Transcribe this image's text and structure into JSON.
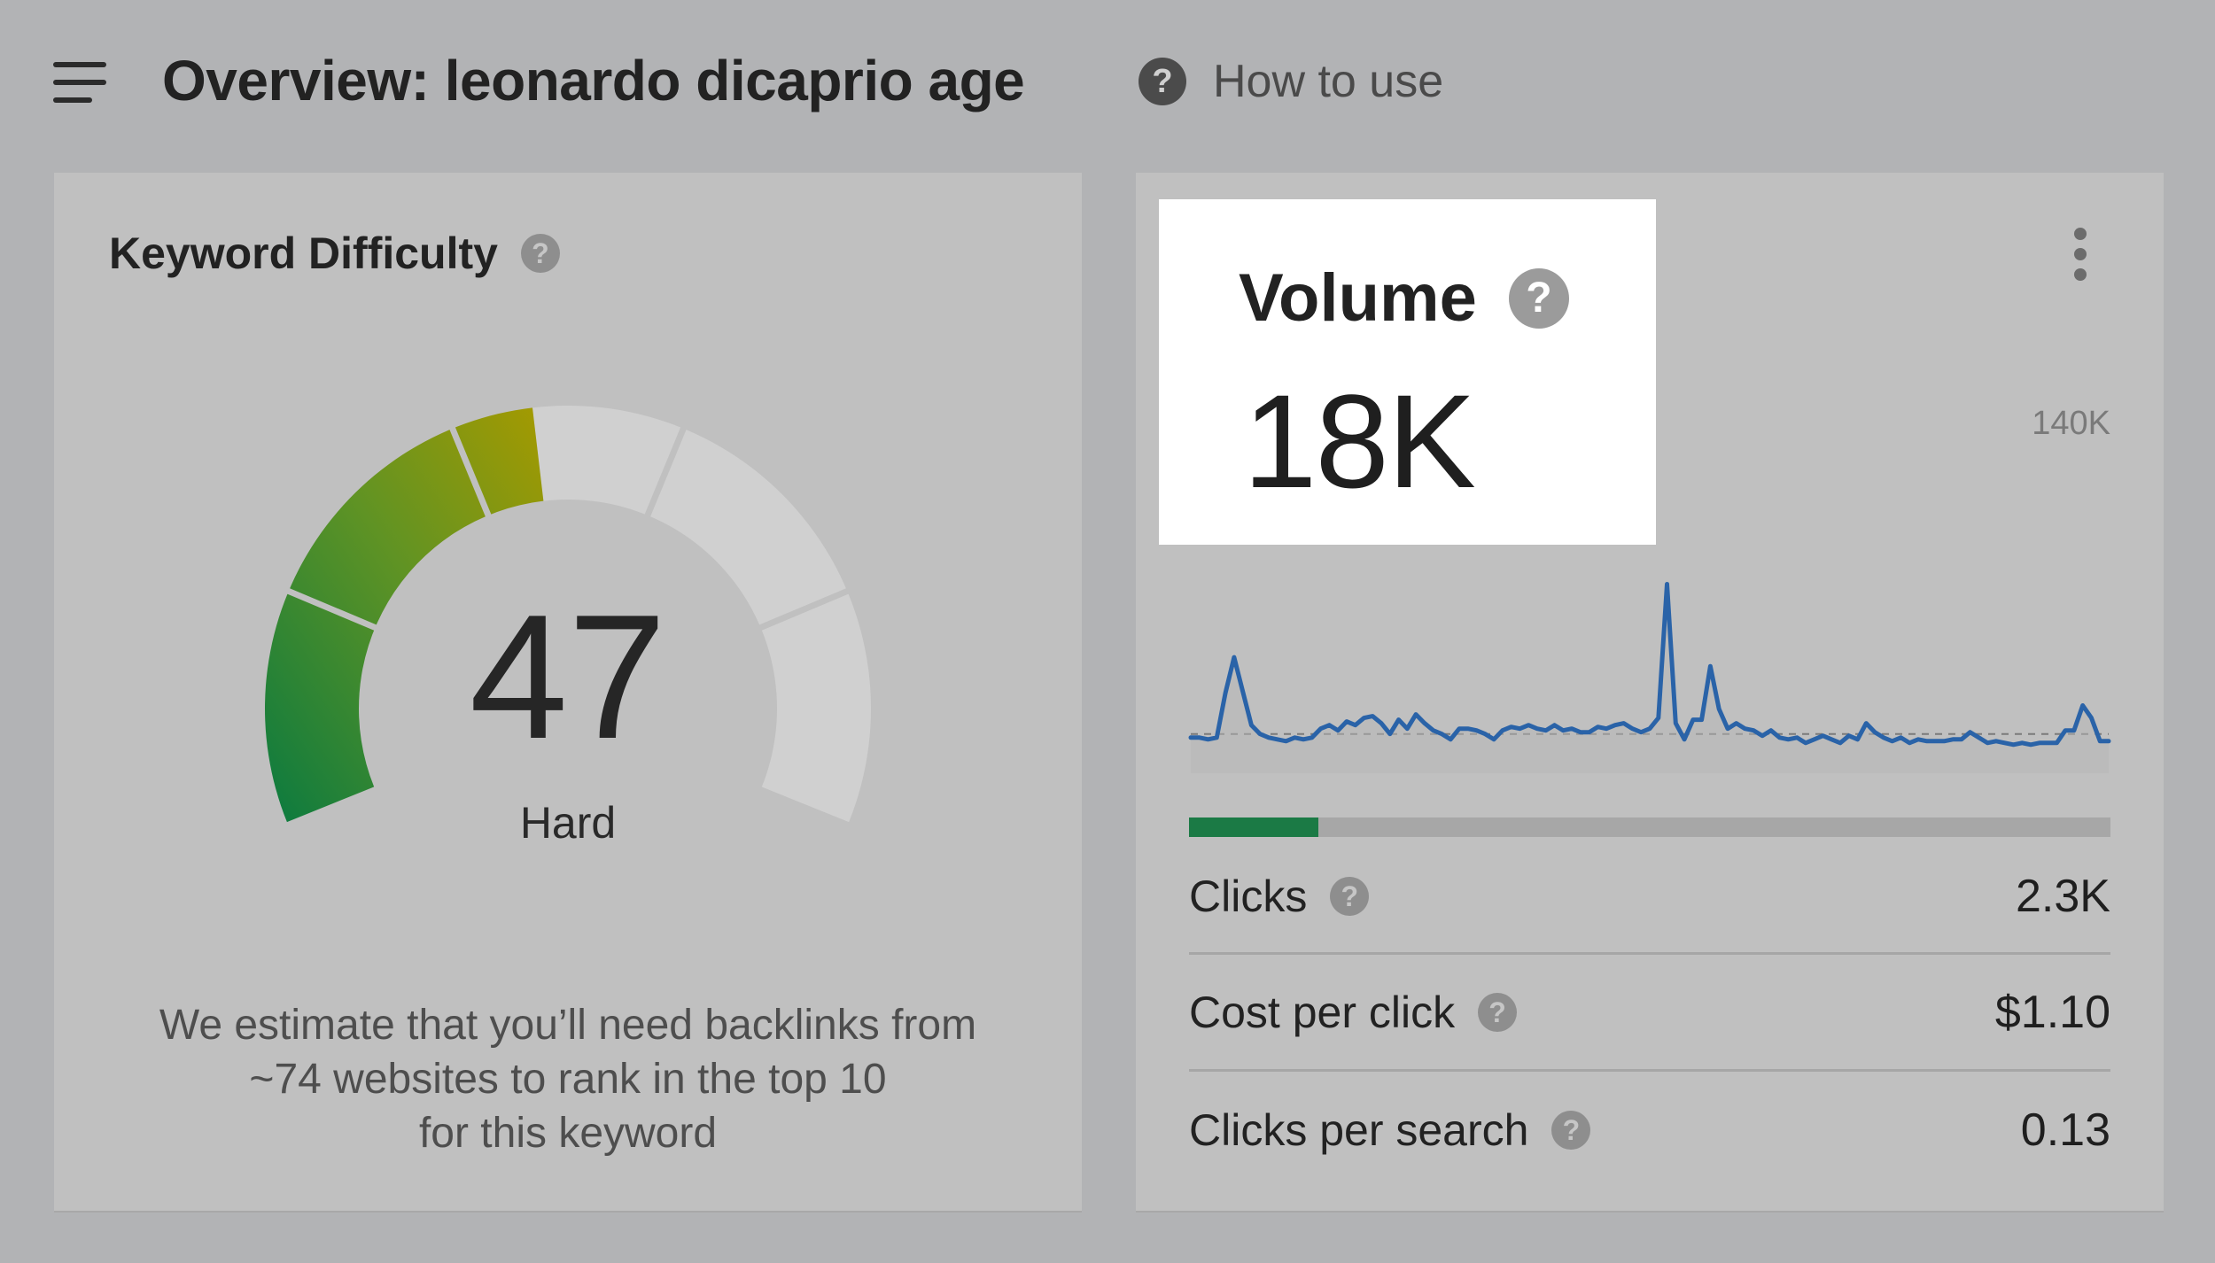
{
  "header": {
    "title": "Overview: leonardo dicaprio age",
    "help_label": "How to use",
    "help_icon": "?"
  },
  "keyword_difficulty": {
    "title": "Keyword Difficulty",
    "help_icon": "?",
    "value": 47,
    "value_text": "47",
    "level": "Hard",
    "description_lines": [
      "We estimate that you’ll need backlinks from",
      "~74 websites to rank in the top 10",
      "for this keyword"
    ],
    "gauge_colors": {
      "green": "#0a7a40",
      "olive": "#7c9a1e",
      "yellow": "#a59a00",
      "track": "#d0d0d0"
    }
  },
  "volume": {
    "title": "Volume",
    "help_icon": "?",
    "value_text": "18K",
    "axis_max": "140K",
    "clicks_share": 0.14,
    "line_color": "#2a63a8",
    "bar_color": "#1b7a45",
    "metrics": [
      {
        "label": "Clicks",
        "value": "2.3K"
      },
      {
        "label": "Cost per click",
        "value": "$1.10"
      },
      {
        "label": "Clicks per search",
        "value": "0.13"
      }
    ]
  },
  "chart_data": {
    "type": "line",
    "series": [
      {
        "values": [
          17,
          17,
          16,
          17,
          42,
          62,
          43,
          24,
          19,
          17,
          16,
          15,
          17,
          16,
          17,
          22,
          24,
          21,
          26,
          24,
          28,
          29,
          25,
          19,
          27,
          22,
          30,
          25,
          21,
          19,
          16,
          22,
          22,
          21,
          19,
          16,
          21,
          23,
          22,
          24,
          22,
          21,
          24,
          21,
          22,
          20,
          20,
          23,
          22,
          24,
          25,
          22,
          20,
          22,
          28,
          103,
          25,
          16,
          27,
          27,
          57,
          33,
          22,
          25,
          22,
          21,
          18,
          21,
          17,
          16,
          17,
          14,
          16,
          18,
          16,
          14,
          18,
          16,
          25,
          20,
          17,
          15,
          17,
          14,
          16,
          15,
          15,
          15,
          16,
          16,
          20,
          17,
          14,
          15,
          14,
          13,
          14,
          13,
          14,
          14,
          14,
          21,
          21,
          35,
          28,
          15,
          15
        ]
      }
    ],
    "ylim": [
      0,
      140
    ],
    "average_line": 19
  }
}
